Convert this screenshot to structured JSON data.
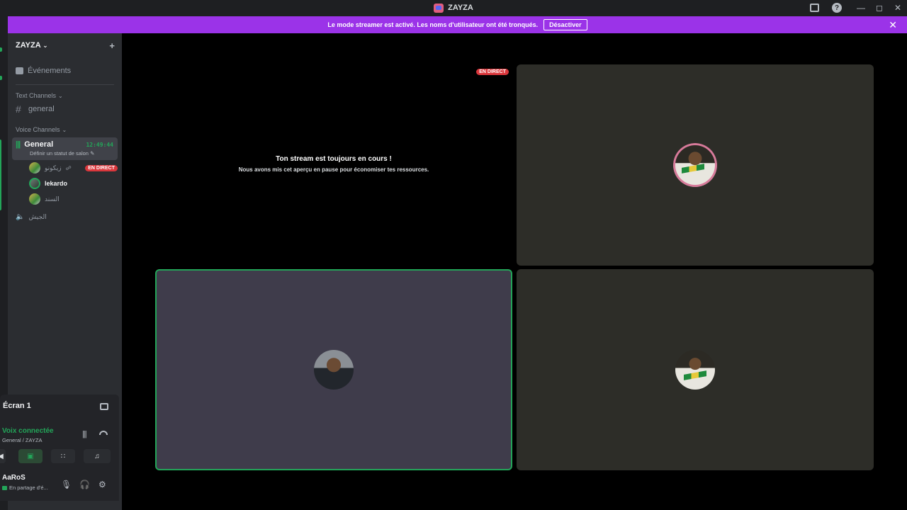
{
  "window": {
    "title": "ZAYZA"
  },
  "banner": {
    "message": "Le mode streamer est activé. Les noms d'utilisateur ont été tronqués.",
    "button": "Désactiver"
  },
  "sidebar": {
    "server_name": "ZAYZA",
    "events_label": "Événements",
    "text_category": "Text Channels",
    "text_channels": [
      "general"
    ],
    "voice_category": "Voice Channels",
    "voice_channel": {
      "name": "General",
      "timer": "12:49:44",
      "status": "Définir un statut de salon"
    },
    "members": [
      {
        "name": "زيكونو",
        "live": "EN DIRECT"
      },
      {
        "name": "lekardo"
      },
      {
        "name": "السند"
      }
    ],
    "other_voice": "الجيش"
  },
  "panel": {
    "screen_title": "Écran 1",
    "voice_connected": "Voix connectée",
    "voice_location": "General / ZAYZA",
    "username": "AaRoS",
    "user_status": "En partage d'é..."
  },
  "stage": {
    "live_tag": "EN DIRECT",
    "stream_title": "Ton stream est toujours en cours !",
    "stream_sub": "Nous avons mis cet aperçu en pause pour économiser tes ressources."
  },
  "colors": {
    "banner": "#9b33e8",
    "online": "#23a559",
    "live": "#da373c"
  }
}
